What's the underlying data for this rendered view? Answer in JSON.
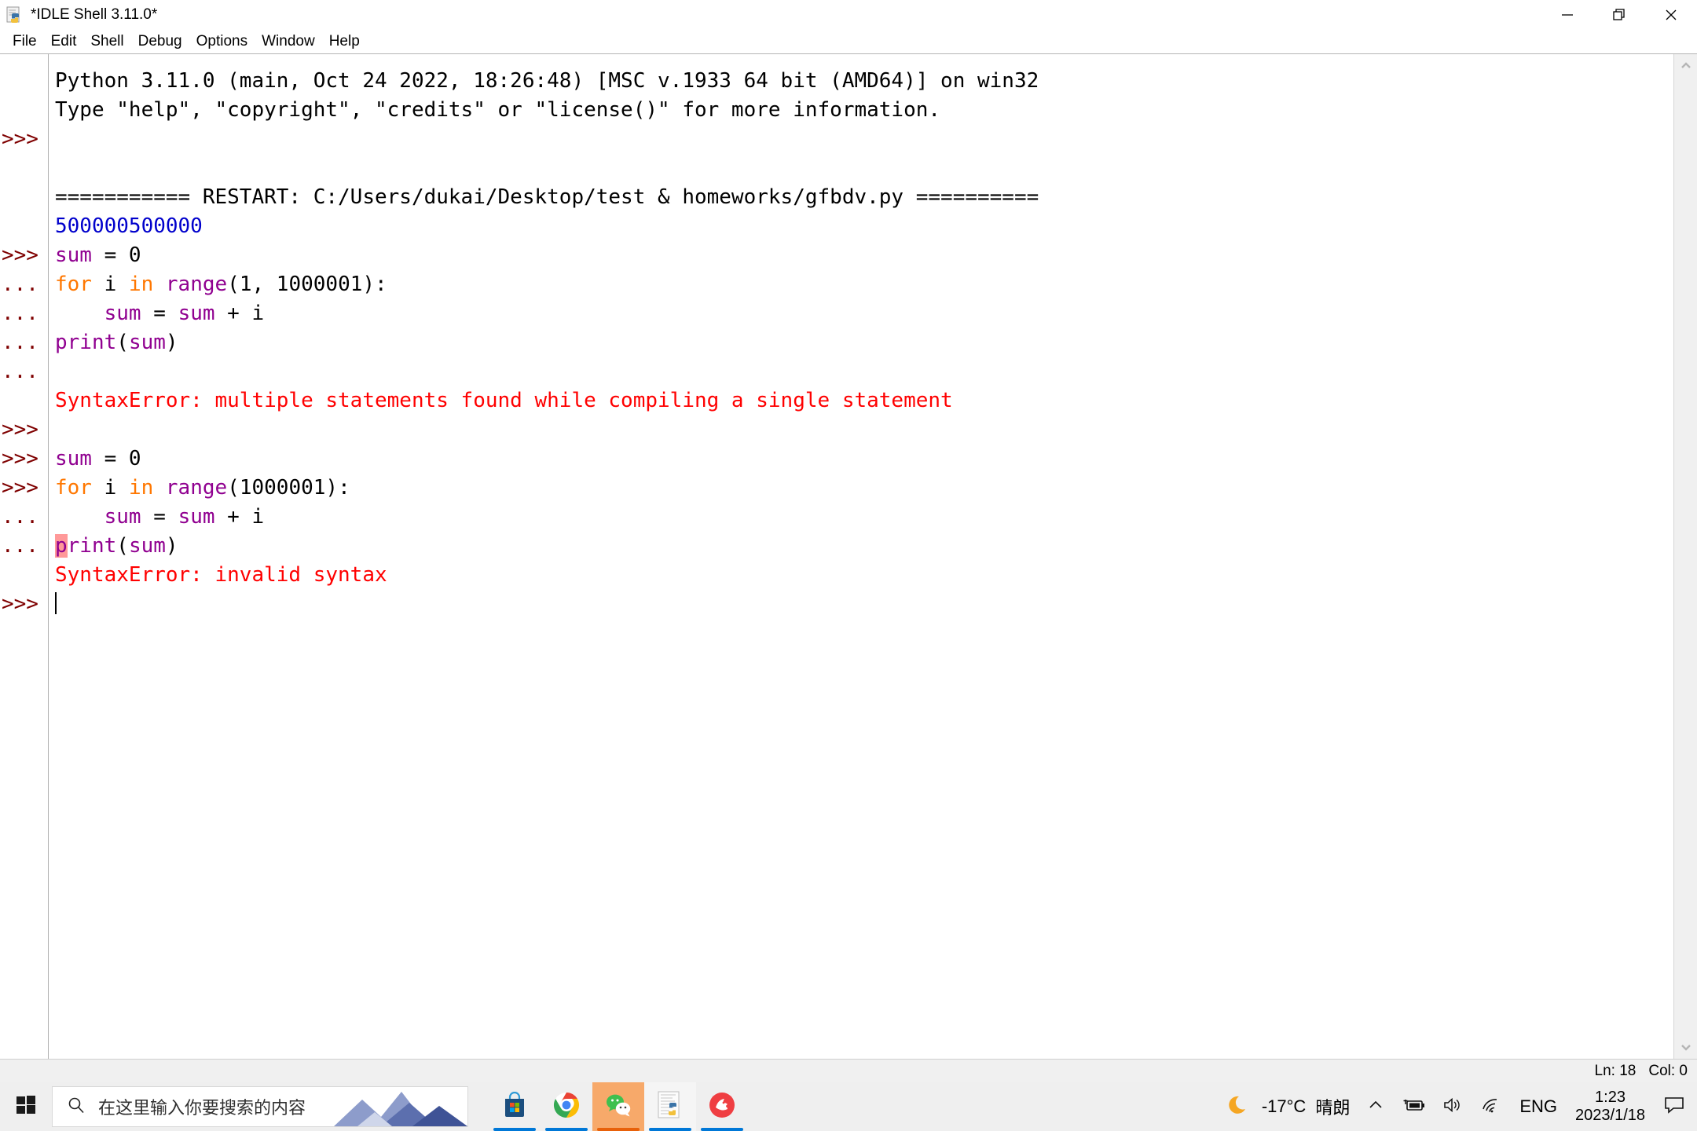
{
  "window": {
    "title": "*IDLE Shell 3.11.0*",
    "icon": "python-idle-icon",
    "controls": [
      {
        "name": "minimize-button",
        "glyph": "minimize-icon"
      },
      {
        "name": "restore-button",
        "glyph": "restore-icon"
      },
      {
        "name": "close-button",
        "glyph": "close-icon"
      }
    ]
  },
  "menubar": {
    "items": [
      {
        "label": "File"
      },
      {
        "label": "Edit"
      },
      {
        "label": "Shell"
      },
      {
        "label": "Debug"
      },
      {
        "label": "Options"
      },
      {
        "label": "Window"
      },
      {
        "label": "Help"
      }
    ]
  },
  "shell": {
    "prompts": [
      "",
      "",
      ">>>",
      "",
      "",
      ">>>",
      "...",
      "...",
      "...",
      "...",
      "",
      ">>>",
      ">>>",
      ">>>",
      ">>>",
      "...",
      "...",
      "",
      ">>>"
    ],
    "lines": [
      {
        "prompt": "",
        "segments": [
          {
            "t": "Python 3.11.0 (main, Oct 24 2022, 18:26:48) [MSC v.1933 64 bit (AMD64)] on win32",
            "c": "plain"
          }
        ]
      },
      {
        "prompt": "",
        "segments": [
          {
            "t": "Type \"help\", \"copyright\", \"credits\" or \"license()\" for more information.",
            "c": "plain"
          }
        ]
      },
      {
        "prompt": ">>>",
        "segments": [
          {
            "t": "",
            "c": "plain"
          }
        ]
      },
      {
        "prompt": "",
        "segments": [
          {
            "t": "",
            "c": "plain"
          }
        ]
      },
      {
        "prompt": "",
        "segments": [
          {
            "t": "=========== RESTART: C:/Users/dukai/Desktop/test & homeworks/gfbdv.py ==========",
            "c": "plain"
          }
        ]
      },
      {
        "prompt": "",
        "segments": [
          {
            "t": "500000500000",
            "c": "output"
          }
        ]
      },
      {
        "prompt": ">>>",
        "segments": [
          {
            "t": "sum",
            "c": "builtin"
          },
          {
            "t": " = 0",
            "c": "plain"
          }
        ]
      },
      {
        "prompt": "...",
        "segments": [
          {
            "t": "for",
            "c": "keyword"
          },
          {
            "t": " i ",
            "c": "plain"
          },
          {
            "t": "in",
            "c": "keyword"
          },
          {
            "t": " ",
            "c": "plain"
          },
          {
            "t": "range",
            "c": "builtin"
          },
          {
            "t": "(1, 1000001):",
            "c": "plain"
          }
        ]
      },
      {
        "prompt": "...",
        "segments": [
          {
            "t": "    ",
            "c": "plain"
          },
          {
            "t": "sum",
            "c": "builtin"
          },
          {
            "t": " = ",
            "c": "plain"
          },
          {
            "t": "sum",
            "c": "builtin"
          },
          {
            "t": " + i",
            "c": "plain"
          }
        ]
      },
      {
        "prompt": "...",
        "segments": [
          {
            "t": "print",
            "c": "builtin"
          },
          {
            "t": "(",
            "c": "plain"
          },
          {
            "t": "sum",
            "c": "builtin"
          },
          {
            "t": ")",
            "c": "plain"
          }
        ]
      },
      {
        "prompt": "...",
        "segments": [
          {
            "t": "",
            "c": "plain"
          }
        ]
      },
      {
        "prompt": "",
        "segments": [
          {
            "t": "SyntaxError: multiple statements found while compiling a single statement",
            "c": "error"
          }
        ]
      },
      {
        "prompt": ">>>",
        "segments": [
          {
            "t": "",
            "c": "plain"
          }
        ]
      },
      {
        "prompt": ">>>",
        "segments": [
          {
            "t": "sum",
            "c": "builtin"
          },
          {
            "t": " = 0",
            "c": "plain"
          }
        ]
      },
      {
        "prompt": ">>>",
        "segments": [
          {
            "t": "for",
            "c": "keyword"
          },
          {
            "t": " i ",
            "c": "plain"
          },
          {
            "t": "in",
            "c": "keyword"
          },
          {
            "t": " ",
            "c": "plain"
          },
          {
            "t": "range",
            "c": "builtin"
          },
          {
            "t": "(1000001):",
            "c": "plain"
          }
        ]
      },
      {
        "prompt": "...",
        "segments": [
          {
            "t": "    ",
            "c": "plain"
          },
          {
            "t": "sum",
            "c": "builtin"
          },
          {
            "t": " = ",
            "c": "plain"
          },
          {
            "t": "sum",
            "c": "builtin"
          },
          {
            "t": " + i",
            "c": "plain"
          }
        ]
      },
      {
        "prompt": "...",
        "segments": [
          {
            "t": "p",
            "c": "hit"
          },
          {
            "t": "rint",
            "c": "builtin"
          },
          {
            "t": "(",
            "c": "plain"
          },
          {
            "t": "sum",
            "c": "builtin"
          },
          {
            "t": ")",
            "c": "plain"
          }
        ]
      },
      {
        "prompt": "",
        "segments": [
          {
            "t": "SyntaxError: invalid syntax",
            "c": "error"
          }
        ]
      },
      {
        "prompt": ">>>",
        "segments": [
          {
            "t": "",
            "c": "plain"
          },
          {
            "t": "__CARET__",
            "c": "caret"
          }
        ]
      }
    ]
  },
  "scrollbar": {
    "up_arrow": "chevron-up-icon",
    "down_arrow": "chevron-down-icon"
  },
  "statusbar": {
    "line_label": "Ln: 18",
    "col_label": "Col: 0"
  },
  "taskbar": {
    "start": "windows-start-icon",
    "search": {
      "placeholder": "在这里输入你要搜索的内容",
      "icon": "search-icon"
    },
    "apps": [
      {
        "name": "microsoft-store",
        "icon": "store-icon",
        "active": false,
        "underline": "#0078d7"
      },
      {
        "name": "google-chrome",
        "icon": "chrome-icon",
        "active": false,
        "underline": "#0078d7"
      },
      {
        "name": "wechat",
        "icon": "wechat-icon",
        "active": true,
        "underline": "#e8610a"
      },
      {
        "name": "python-idle",
        "icon": "idle-window-icon",
        "active": true,
        "underline": "#0078d7"
      },
      {
        "name": "pdf-reader",
        "icon": "foxit-icon",
        "active": false,
        "underline": "#0078d7"
      }
    ],
    "tray": {
      "weather_icon": "moon-icon",
      "weather_temp": "-17°C",
      "weather_desc": "晴朗",
      "overflow_icon": "chevron-up-icon",
      "battery_icon": "battery-charging-icon",
      "volume_icon": "speaker-icon",
      "network_icon": "wifi-icon",
      "language": "ENG",
      "time": "1:23",
      "date": "2023/1/18",
      "action_center_icon": "notification-icon"
    }
  },
  "colors": {
    "builtin": "#900090",
    "keyword": "#ff7700",
    "output": "#0000cc",
    "error": "#ff0000",
    "prompt": "#7f0000",
    "error_highlight": "#ff9999"
  }
}
